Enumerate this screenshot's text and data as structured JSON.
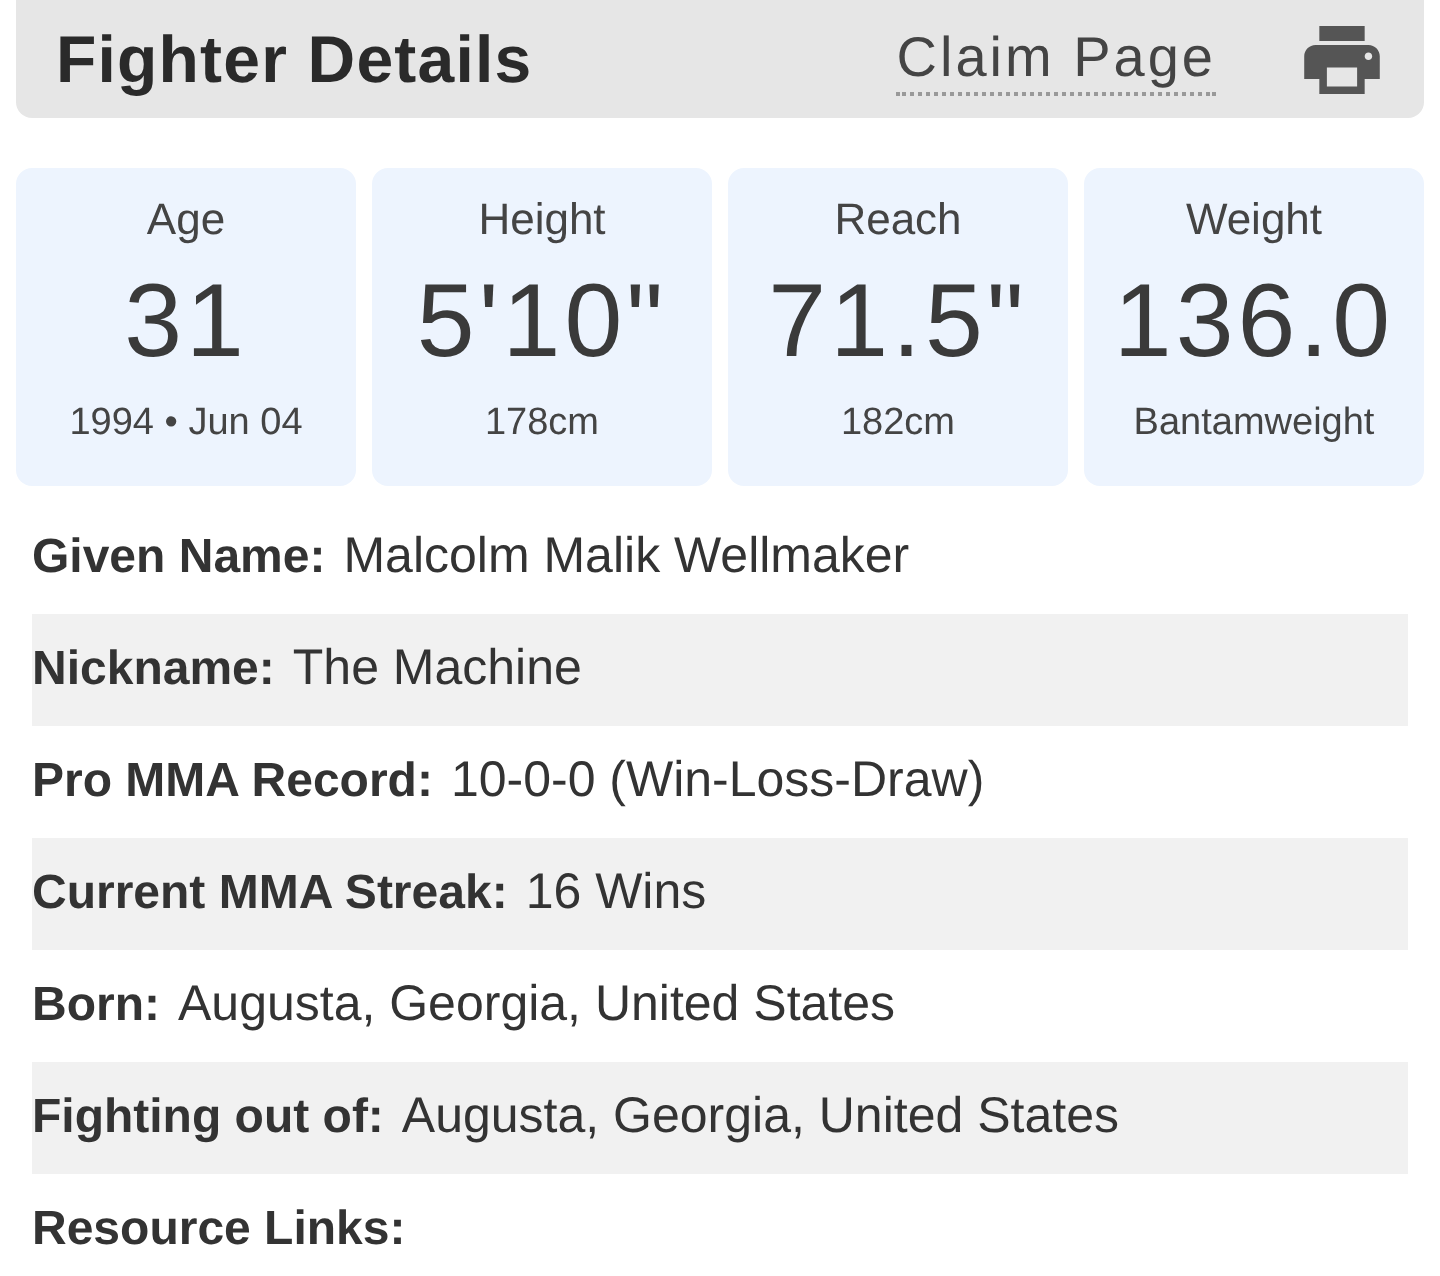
{
  "header": {
    "title": "Fighter Details",
    "claim_link": "Claim Page"
  },
  "stats": [
    {
      "label": "Age",
      "value": "31",
      "detail": "1994 • Jun 04"
    },
    {
      "label": "Height",
      "value": "5'10\"",
      "detail": "178cm"
    },
    {
      "label": "Reach",
      "value": "71.5\"",
      "detail": "182cm"
    },
    {
      "label": "Weight",
      "value": "136.0",
      "detail": "Bantamweight"
    }
  ],
  "details": [
    {
      "label": "Given Name:",
      "value": "Malcolm Malik Wellmaker"
    },
    {
      "label": "Nickname:",
      "value": "The Machine"
    },
    {
      "label": "Pro MMA Record:",
      "value": "10-0-0 (Win-Loss-Draw)"
    },
    {
      "label": "Current MMA Streak:",
      "value": "16 Wins"
    },
    {
      "label": "Born:",
      "value": "Augusta, Georgia, United States"
    },
    {
      "label": "Fighting out of:",
      "value": "Augusta, Georgia, United States"
    },
    {
      "label": "Resource Links:"
    }
  ]
}
